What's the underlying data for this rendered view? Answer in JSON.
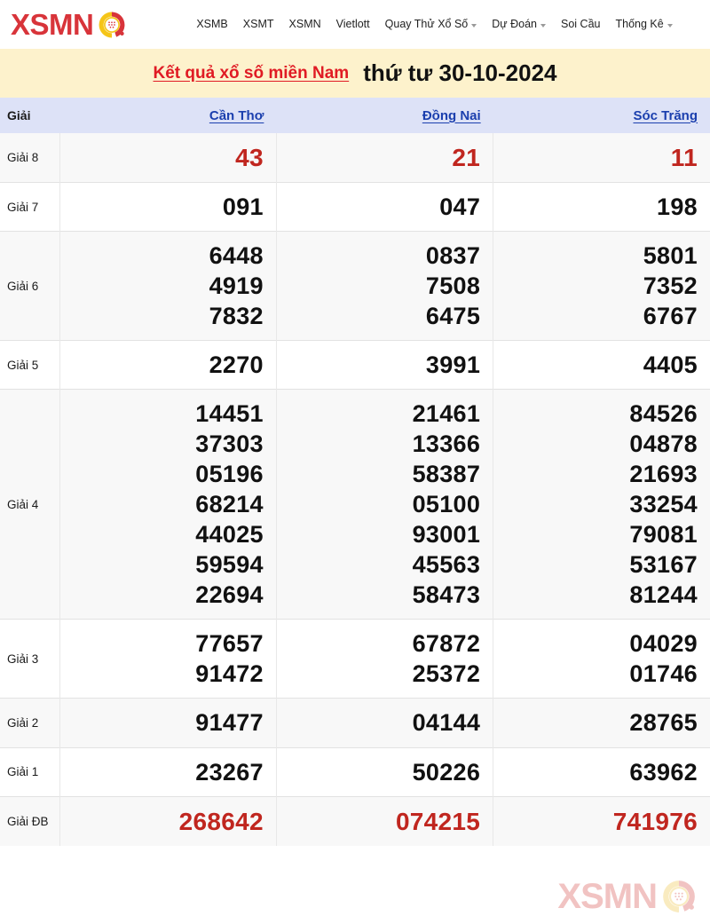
{
  "brand": {
    "text": "XSMN",
    "mark_icon": "lottery-ball-icon",
    "accent_color": "#d8343a",
    "mark_color": "#f5c518"
  },
  "nav": {
    "items": [
      {
        "label": "XSMB",
        "has_dropdown": false
      },
      {
        "label": "XSMT",
        "has_dropdown": false
      },
      {
        "label": "XSMN",
        "has_dropdown": false
      },
      {
        "label": "Vietlott",
        "has_dropdown": false
      },
      {
        "label": "Quay Thử Xổ Số",
        "has_dropdown": true
      },
      {
        "label": "Dự Đoán",
        "has_dropdown": true
      },
      {
        "label": "Soi Cầu",
        "has_dropdown": false
      },
      {
        "label": "Thống Kê",
        "has_dropdown": true
      }
    ]
  },
  "title": {
    "link_text": "Kết quả xổ số miền Nam",
    "date_text": "thứ tư 30-10-2024",
    "strip_color": "#fdf2cc",
    "link_color": "#e01b24"
  },
  "table": {
    "header_bg": "#dde2f7",
    "label_column_header": "Giải",
    "provinces": [
      "Cần Thơ",
      "Đồng Nai",
      "Sóc Trăng"
    ],
    "rows": [
      {
        "label": "Giải 8",
        "highlight": "red",
        "shaded": true,
        "values": [
          [
            "43"
          ],
          [
            "21"
          ],
          [
            "11"
          ]
        ]
      },
      {
        "label": "Giải 7",
        "highlight": "none",
        "shaded": false,
        "values": [
          [
            "091"
          ],
          [
            "047"
          ],
          [
            "198"
          ]
        ]
      },
      {
        "label": "Giải 6",
        "highlight": "none",
        "shaded": true,
        "values": [
          [
            "6448",
            "4919",
            "7832"
          ],
          [
            "0837",
            "7508",
            "6475"
          ],
          [
            "5801",
            "7352",
            "6767"
          ]
        ]
      },
      {
        "label": "Giải 5",
        "highlight": "none",
        "shaded": false,
        "values": [
          [
            "2270"
          ],
          [
            "3991"
          ],
          [
            "4405"
          ]
        ]
      },
      {
        "label": "Giải 4",
        "highlight": "none",
        "shaded": true,
        "values": [
          [
            "14451",
            "37303",
            "05196",
            "68214",
            "44025",
            "59594",
            "22694"
          ],
          [
            "21461",
            "13366",
            "58387",
            "05100",
            "93001",
            "45563",
            "58473"
          ],
          [
            "84526",
            "04878",
            "21693",
            "33254",
            "79081",
            "53167",
            "81244"
          ]
        ]
      },
      {
        "label": "Giải 3",
        "highlight": "none",
        "shaded": false,
        "values": [
          [
            "77657",
            "91472"
          ],
          [
            "67872",
            "25372"
          ],
          [
            "04029",
            "01746"
          ]
        ]
      },
      {
        "label": "Giải 2",
        "highlight": "none",
        "shaded": true,
        "values": [
          [
            "91477"
          ],
          [
            "04144"
          ],
          [
            "28765"
          ]
        ]
      },
      {
        "label": "Giải 1",
        "highlight": "none",
        "shaded": false,
        "values": [
          [
            "23267"
          ],
          [
            "50226"
          ],
          [
            "63962"
          ]
        ]
      },
      {
        "label": "Giải ĐB",
        "highlight": "red",
        "shaded": true,
        "values": [
          [
            "268642"
          ],
          [
            "074215"
          ],
          [
            "741976"
          ]
        ]
      }
    ]
  },
  "watermark": {
    "text": "XSMN",
    "mark_icon": "lottery-ball-icon"
  }
}
